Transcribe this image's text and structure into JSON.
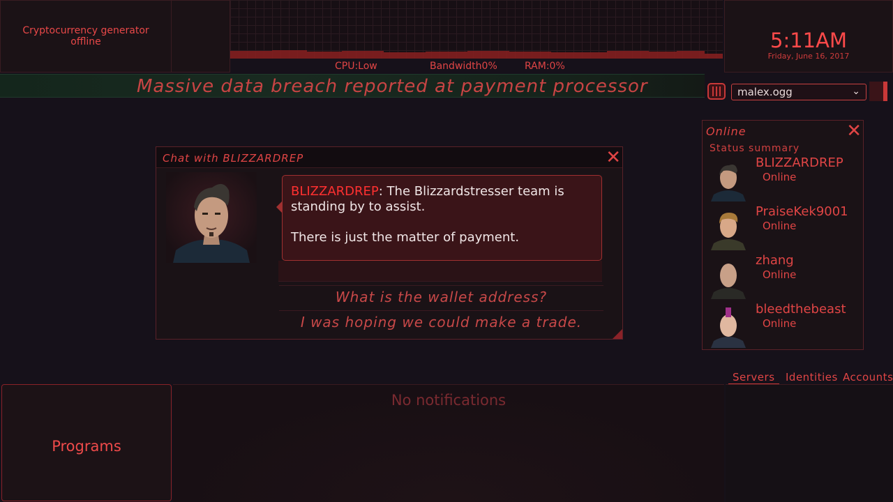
{
  "crypto": {
    "status": "Cryptocurrency generator offline"
  },
  "stats": {
    "cpu": "CPU:Low",
    "bandwidth": "Bandwidth0%",
    "ram": "RAM:0%"
  },
  "clock": {
    "time": "5:11AM",
    "date": "Friday, June 16, 2017"
  },
  "headline": "Massive data breach reported at payment processor",
  "music": {
    "track": "malex.ogg"
  },
  "chat": {
    "title": "Chat with BLIZZARDREP",
    "sender": "BLIZZARDREP",
    "message1": ": The Blizzardstresser team is standing by to assist.",
    "message2": "There is just the matter of payment.",
    "replies": [
      "What is the wallet address?",
      "I was hoping we could make a trade."
    ]
  },
  "online": {
    "title": "Online",
    "summary_label": "Status summary",
    "contacts": [
      {
        "name": "BLIZZARDREP",
        "status": "Online"
      },
      {
        "name": "PraiseKek9001",
        "status": "Online"
      },
      {
        "name": "zhang",
        "status": "Online"
      },
      {
        "name": "bleedthebeast",
        "status": "Online"
      }
    ]
  },
  "tabs": [
    "Servers",
    "Identities",
    "Accounts"
  ],
  "programs_label": "Programs",
  "notifications": "No notifications",
  "colors": {
    "accent": "#e04545",
    "panel": "#1a1216",
    "headline_bar": "#192a20"
  }
}
